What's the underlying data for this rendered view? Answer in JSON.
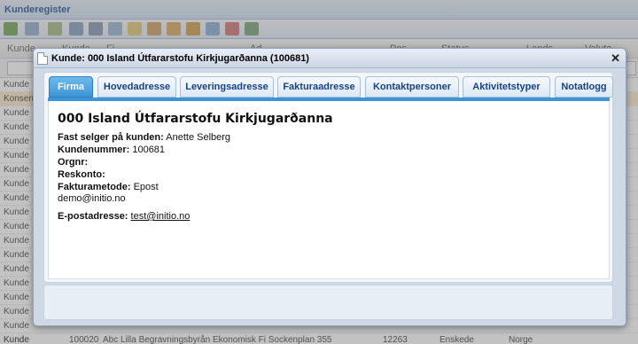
{
  "app": {
    "title": "Kunderegister"
  },
  "toolbar": {
    "icons": [
      "add-customer-icon",
      "edit-customer-icon",
      "import-icon",
      "export-icon",
      "print-icon",
      "copy-icon",
      "note-icon",
      "address-book-icon",
      "user-add-icon",
      "user-remove-icon",
      "filter-icon",
      "clear-filter-icon",
      "export-excel-icon"
    ]
  },
  "grid": {
    "columns": [
      "Kunde",
      "Kunde",
      "Fi",
      "Ad",
      "Pos",
      "Status",
      "Lands",
      "Valuta"
    ],
    "rows": [
      "Kunde",
      "Konsern",
      "Kunde",
      "Kunde",
      "Kunde",
      "Kunde",
      "Kunde",
      "Kunde",
      "Kunde",
      "Kunde",
      "Kunde",
      "Kunde",
      "Kunde",
      "Kunde",
      "Kunde",
      "Kunde",
      "Kunde",
      "Kunde",
      "Kunde"
    ],
    "last_row": {
      "type": "Kunde",
      "number": "100020",
      "name": "Abc Lilla Begravningsbyrån Ekonomisk Fi Sockenplan 355",
      "postal": "12263",
      "status": "Enskede",
      "country": "Norge"
    }
  },
  "window": {
    "title": "Kunde: 000 Island Útfararstofu Kirkjugarðanna (100681)",
    "close": "✕",
    "tabs": [
      "Firma",
      "Hovedadresse",
      "Leveringsadresse",
      "Fakturaadresse",
      "Kontaktpersoner",
      "Aktivitetstyper",
      "Notatlogg"
    ],
    "active_tab": "Firma"
  },
  "firma": {
    "name": "000 Island Útfararstofu Kirkjugarðanna",
    "seller_label": "Fast selger på kunden:",
    "seller_value": " Anette Selberg",
    "customer_number_label": "Kundenummer:",
    "customer_number_value": " 100681",
    "orgnr_label": "Orgnr:",
    "reskonto_label": "Reskonto:",
    "invoice_method_label": "Fakturametode:",
    "invoice_method_value": " Epost",
    "invoice_email": "demo@initio.no",
    "email_label": "E-postadresse:",
    "email_value": "test@initio.no"
  }
}
